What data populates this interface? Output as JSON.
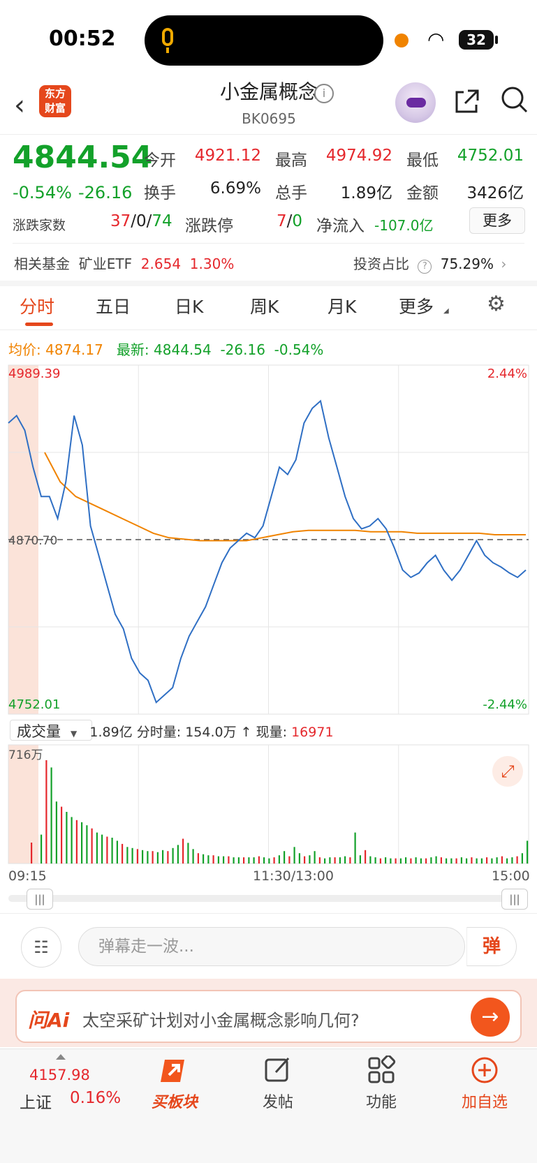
{
  "status": {
    "time": "00:52",
    "battery": "32"
  },
  "header": {
    "logo_line1": "东方",
    "logo_line2": "财富",
    "title": "小金属概念",
    "code": "BK0695"
  },
  "quote": {
    "price": "4844.54",
    "change_pct": "-0.54%",
    "change": "-26.16",
    "open_label": "今开",
    "open": "4921.12",
    "high_label": "最高",
    "high": "4974.92",
    "low_label": "最低",
    "low": "4752.01",
    "turnover_label": "换手",
    "turnover": "6.69%",
    "volume_label": "总手",
    "volume": "1.89亿",
    "amount_label": "金额",
    "amount": "3426亿",
    "breadth_label": "涨跌家数",
    "breadth_up": "37",
    "breadth_flat": "0",
    "breadth_down": "74",
    "limit_label": "涨跌停",
    "limit_up": "7",
    "limit_down": "0",
    "netflow_label": "净流入",
    "netflow": "-107.0亿",
    "more": "更多"
  },
  "fund": {
    "label": "相关基金",
    "name": "矿业ETF",
    "price": "2.654",
    "pct": "1.30%",
    "ratio_label": "投资占比",
    "ratio": "75.29%"
  },
  "tabs": [
    "分时",
    "五日",
    "日K",
    "周K",
    "月K",
    "更多"
  ],
  "avg": {
    "avg_label": "均价:",
    "avg": "4874.17",
    "latest_label": "最新:",
    "latest": "4844.54",
    "change": "-26.16",
    "pct": "-0.54%"
  },
  "chart_data": {
    "type": "line",
    "title": "",
    "ylim": [
      4752.01,
      4989.39
    ],
    "y_labels": {
      "top": "4989.39",
      "mid": "4870.70",
      "bottom": "4752.01",
      "top_pct": "2.44%",
      "bottom_pct": "-2.44%"
    },
    "x_labels": [
      "09:15",
      "11:30/13:00",
      "15:00"
    ],
    "series": [
      {
        "name": "最新",
        "color": "#2f6fc4",
        "values": [
          4950,
          4955,
          4945,
          4920,
          4900,
          4900,
          4885,
          4910,
          4955,
          4935,
          4880,
          4860,
          4840,
          4820,
          4810,
          4790,
          4780,
          4775,
          4760,
          4765,
          4770,
          4790,
          4805,
          4815,
          4825,
          4840,
          4855,
          4865,
          4870,
          4875,
          4872,
          4880,
          4900,
          4920,
          4915,
          4925,
          4950,
          4960,
          4965,
          4940,
          4920,
          4900,
          4885,
          4878,
          4880,
          4885,
          4878,
          4865,
          4850,
          4845,
          4848,
          4855,
          4860,
          4850,
          4843,
          4850,
          4860,
          4870,
          4860,
          4855,
          4852,
          4848,
          4845,
          4850
        ]
      },
      {
        "name": "均价",
        "color": "#f08300",
        "values": [
          4930,
          4910,
          4900,
          4895,
          4890,
          4885,
          4880,
          4875,
          4872,
          4871,
          4870,
          4870,
          4870,
          4870,
          4872,
          4874,
          4876,
          4877,
          4877,
          4877,
          4877,
          4876,
          4876,
          4876,
          4875,
          4875,
          4875,
          4875,
          4875,
          4874,
          4874,
          4874
        ]
      }
    ]
  },
  "volume": {
    "selector": "成交量",
    "total": "1.89亿",
    "minute_label": "分时量:",
    "minute": "154.0万",
    "current_label": "现量:",
    "current": "16971",
    "max_label": "716万",
    "bars": [
      0.28,
      1.0,
      0.93,
      0.6,
      0.55,
      0.5,
      0.45,
      0.42,
      0.4,
      0.37,
      0.34,
      0.3,
      0.28,
      0.26,
      0.25,
      0.22,
      0.19,
      0.16,
      0.15,
      0.14,
      0.13,
      0.12,
      0.12,
      0.11,
      0.13,
      0.12,
      0.15,
      0.18,
      0.24,
      0.2,
      0.14,
      0.1,
      0.09,
      0.08,
      0.08,
      0.07,
      0.07,
      0.07,
      0.06,
      0.06,
      0.06,
      0.06,
      0.06,
      0.07,
      0.06,
      0.05,
      0.06,
      0.08,
      0.12,
      0.07,
      0.16,
      0.1,
      0.07,
      0.08,
      0.12,
      0.06,
      0.05,
      0.06,
      0.06,
      0.06,
      0.07,
      0.06,
      0.3,
      0.08,
      0.13,
      0.07,
      0.06,
      0.05,
      0.06,
      0.05,
      0.05,
      0.05,
      0.06,
      0.05,
      0.06,
      0.05,
      0.05,
      0.06,
      0.07,
      0.06,
      0.05,
      0.05,
      0.05,
      0.06,
      0.05,
      0.06,
      0.05,
      0.05,
      0.06,
      0.05,
      0.06,
      0.07,
      0.05,
      0.06,
      0.07,
      0.1,
      0.22
    ]
  },
  "danmu": {
    "placeholder": "弹幕走一波...",
    "send": "弹"
  },
  "ai": {
    "logo": "问Ai",
    "question": "太空采矿计划对小金属概念影响几何?"
  },
  "index": {
    "value": "4157.98",
    "name": "上证",
    "pct": "0.16%"
  },
  "nav": [
    {
      "label": "买板块"
    },
    {
      "label": "发帖"
    },
    {
      "label": "功能"
    },
    {
      "label": "加自选"
    }
  ]
}
